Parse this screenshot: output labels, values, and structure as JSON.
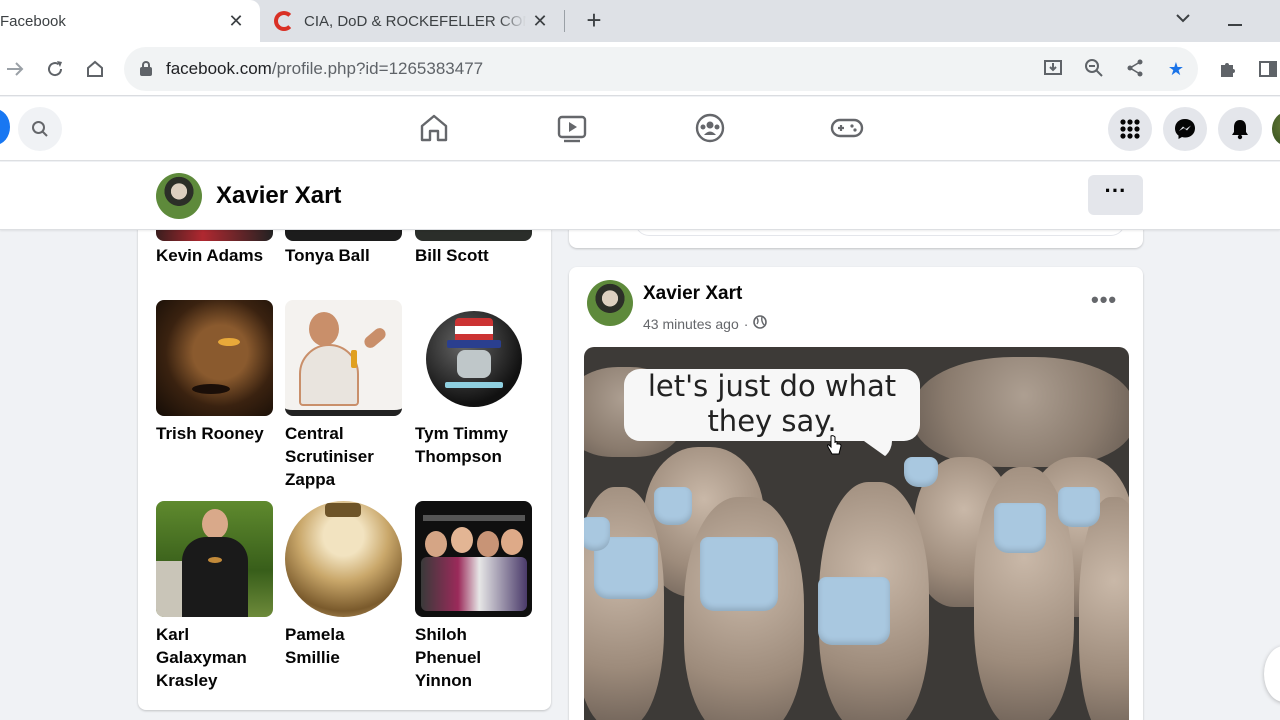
{
  "browser": {
    "tabs": [
      {
        "title": "Facebook",
        "active": true
      },
      {
        "title": "CIA, DoD & ROCKEFELLER CONF",
        "active": false
      }
    ],
    "url_host": "facebook.com",
    "url_path": "/profile.php?id=1265383477"
  },
  "profile": {
    "name": "Xavier Xart",
    "more_label": "···"
  },
  "friends": {
    "top_row": [
      "Kevin Adams",
      "Tonya Ball",
      "Bill Scott"
    ],
    "row2": [
      "Trish Rooney",
      "Central Scrutiniser Zappa",
      "Tym Timmy Thompson"
    ],
    "row3": [
      "Karl Galaxyman Krasley",
      "Pamela Smillie",
      "Shiloh Phenuel Yinnon"
    ]
  },
  "post": {
    "author": "Xavier Xart",
    "time": "43 minutes ago",
    "separator": "·",
    "image_caption": "let's just do what they say."
  },
  "colors": {
    "fb_blue": "#1877f2",
    "star_blue": "#1a73e8"
  }
}
